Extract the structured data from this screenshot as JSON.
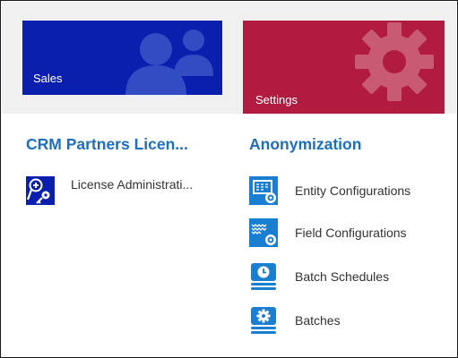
{
  "tiles": {
    "sales": {
      "label": "Sales",
      "icon": "people-icon",
      "color": "#0a1fae"
    },
    "settings": {
      "label": "Settings",
      "icon": "gear-icon",
      "color": "#b11b3f"
    }
  },
  "groups": {
    "crm": {
      "title": "CRM Partners Licen...",
      "items": [
        {
          "label": "License Administrati...",
          "icon": "license-key-icon"
        }
      ]
    },
    "anonymization": {
      "title": "Anonymization",
      "items": [
        {
          "label": "Entity Configurations",
          "icon": "entity-config-icon"
        },
        {
          "label": "Field Configurations",
          "icon": "field-config-icon"
        },
        {
          "label": "Batch Schedules",
          "icon": "batch-schedule-icon"
        },
        {
          "label": "Batches",
          "icon": "batches-icon"
        }
      ]
    }
  },
  "colors": {
    "accent_text": "#1e6ebe",
    "icon_blue": "#1b7fd1",
    "license_icon_bg": "#0a1fae"
  }
}
